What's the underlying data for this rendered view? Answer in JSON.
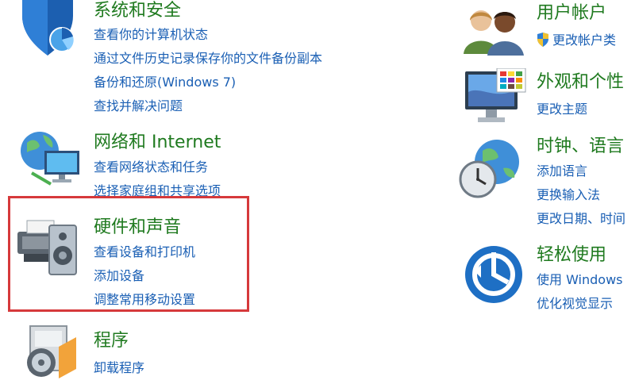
{
  "left": {
    "system_security": {
      "title": "系统和安全",
      "links": [
        "查看你的计算机状态",
        "通过文件历史记录保存你的文件备份副本",
        "备份和还原(Windows 7)",
        "查找并解决问题"
      ]
    },
    "network": {
      "title": "网络和 Internet",
      "links": [
        "查看网络状态和任务",
        "选择家庭组和共享选项"
      ]
    },
    "hardware": {
      "title": "硬件和声音",
      "links": [
        "查看设备和打印机",
        "添加设备",
        "调整常用移动设置"
      ]
    },
    "programs": {
      "title": "程序",
      "links": [
        "卸载程序"
      ]
    }
  },
  "right": {
    "accounts": {
      "title": "用户帐户",
      "links": [
        "更改帐户类"
      ]
    },
    "appearance": {
      "title": "外观和个性",
      "links": [
        "更改主题"
      ]
    },
    "clock": {
      "title": "时钟、语言",
      "links": [
        "添加语言",
        "更换输入法",
        "更改日期、时间"
      ]
    },
    "ease": {
      "title": "轻松使用",
      "links": [
        "使用 Windows",
        "优化视觉显示"
      ]
    }
  },
  "colors": {
    "title_green": "#1f7a1f",
    "link_blue": "#1a5fb4",
    "highlight_red": "#d6393b"
  }
}
